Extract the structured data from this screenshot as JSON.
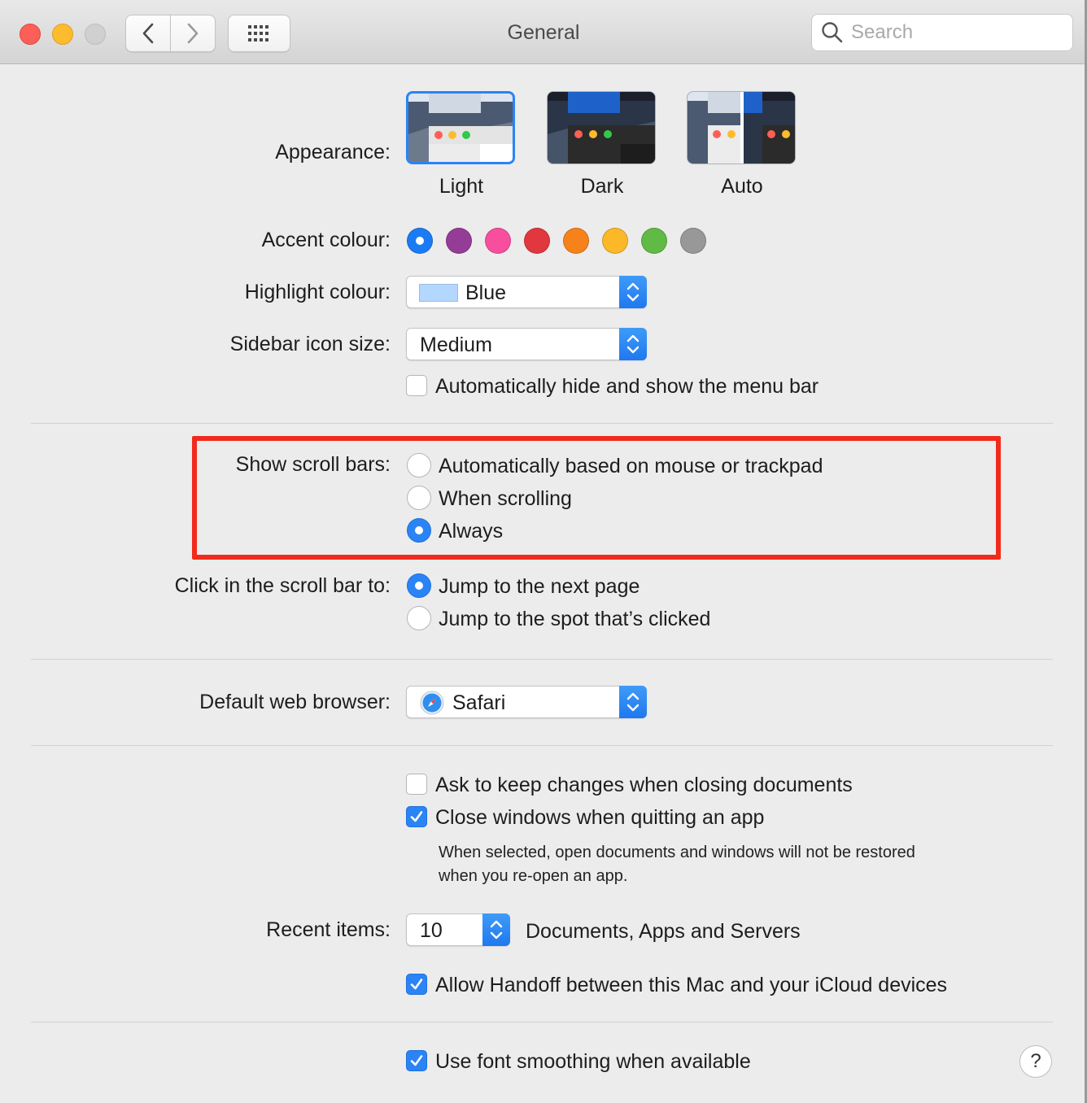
{
  "window": {
    "title": "General",
    "search_placeholder": "Search"
  },
  "appearance": {
    "label": "Appearance:",
    "options": [
      "Light",
      "Dark",
      "Auto"
    ],
    "selected": "Light"
  },
  "accent": {
    "label": "Accent colour:",
    "colors": [
      "#1a7cf5",
      "#953d96",
      "#f74f9e",
      "#e0383e",
      "#f7821b",
      "#fcb827",
      "#62ba46",
      "#989898"
    ],
    "selected_index": 0
  },
  "highlight": {
    "label": "Highlight colour:",
    "value": "Blue",
    "swatch_color": "#b3d7ff"
  },
  "sidebar_icon": {
    "label": "Sidebar icon size:",
    "value": "Medium"
  },
  "menu_bar": {
    "label": "Automatically hide and show the menu bar",
    "checked": false
  },
  "scroll_bars": {
    "label": "Show scroll bars:",
    "options": [
      "Automatically based on mouse or trackpad",
      "When scrolling",
      "Always"
    ],
    "selected": "Always"
  },
  "click_scroll": {
    "label": "Click in the scroll bar to:",
    "options": [
      "Jump to the next page",
      "Jump to the spot that’s clicked"
    ],
    "selected": "Jump to the next page"
  },
  "browser": {
    "label": "Default web browser:",
    "value": "Safari"
  },
  "documents": {
    "ask_keep": "Ask to keep changes when closing documents",
    "ask_keep_checked": false,
    "close_windows": "Close windows when quitting an app",
    "close_windows_checked": true,
    "note_line1": "When selected, open documents and windows will not be restored",
    "note_line2": "when you re-open an app."
  },
  "recent": {
    "label": "Recent items:",
    "value": "10",
    "suffix": "Documents, Apps and Servers"
  },
  "handoff": {
    "label": "Allow Handoff between this Mac and your iCloud devices",
    "checked": true
  },
  "font_smoothing": {
    "label": "Use font smoothing when available",
    "checked": true
  },
  "help": "?"
}
